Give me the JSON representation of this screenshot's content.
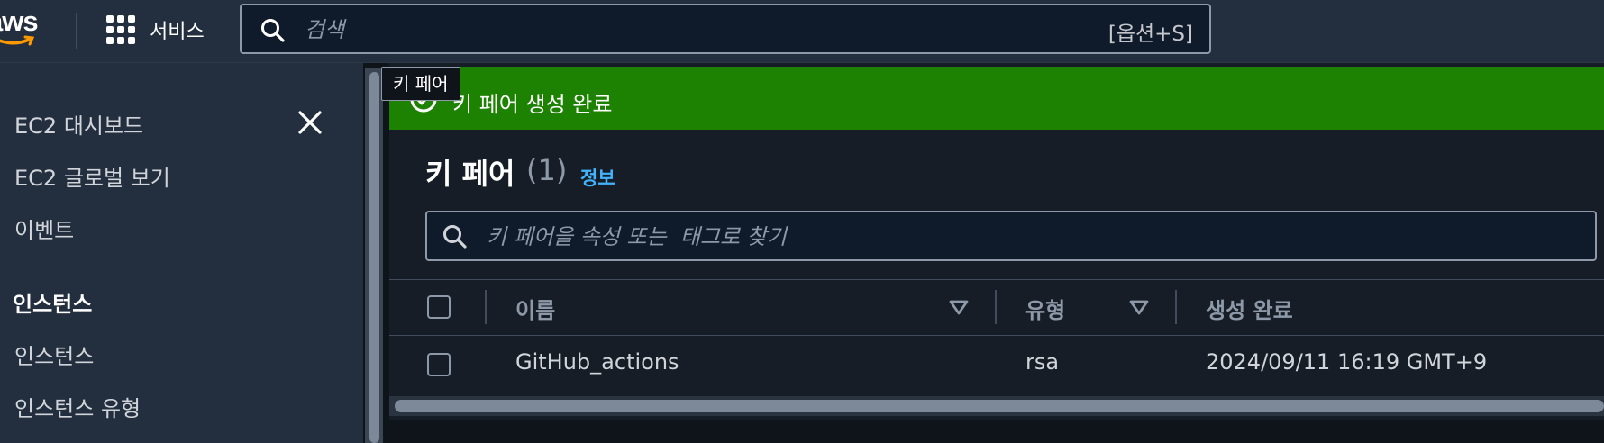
{
  "topnav": {
    "logo_text": "aws",
    "services_label": "서비스",
    "search_placeholder": "검색",
    "search_shortcut": "[옵션+S]"
  },
  "sidebar": {
    "items": [
      {
        "label": "EC2 대시보드"
      },
      {
        "label": "EC2 글로벌 보기"
      },
      {
        "label": "이벤트"
      }
    ],
    "section_heading": "인스턴스",
    "section_items": [
      {
        "label": "인스턴스"
      },
      {
        "label": "인스턴스 유형"
      }
    ]
  },
  "flash": {
    "message": "키 페어 생성 완료",
    "tooltip": "키 페어",
    "color": "#1d8102"
  },
  "panel": {
    "title": "키 페어",
    "count": "(1)",
    "info_link": "정보",
    "filter_placeholder": "키 페어을 속성 또는  태그로 찾기"
  },
  "table": {
    "columns": [
      "이름",
      "유형",
      "생성 완료"
    ],
    "rows": [
      {
        "name": "GitHub_actions",
        "type": "rsa",
        "created": "2024/09/11 16:19 GMT+9"
      }
    ]
  },
  "colors": {
    "nav_bg": "#232f3e",
    "page_bg": "#161d26",
    "link": "#42b4ff",
    "success": "#1d8102"
  }
}
